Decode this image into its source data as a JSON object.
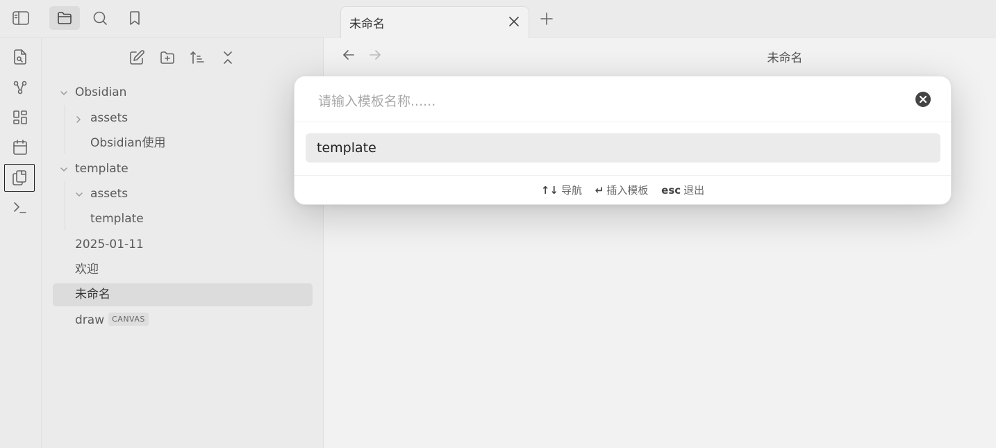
{
  "ribbon": {
    "items": [
      {
        "name": "open-quick-switcher-icon"
      },
      {
        "name": "graph-view-icon"
      },
      {
        "name": "canvas-icon"
      },
      {
        "name": "daily-note-calendar-icon"
      },
      {
        "name": "insert-template-icon"
      },
      {
        "name": "command-palette-icon"
      }
    ]
  },
  "sidebar_tabs": [
    "files",
    "search",
    "bookmarks"
  ],
  "file_tree": {
    "items": [
      {
        "label": "Obsidian",
        "type": "folder",
        "expanded": true,
        "depth": 0
      },
      {
        "label": "assets",
        "type": "folder",
        "expanded": false,
        "depth": 1
      },
      {
        "label": "Obsidian使用",
        "type": "file",
        "depth": 1
      },
      {
        "label": "template",
        "type": "folder",
        "expanded": true,
        "depth": 0
      },
      {
        "label": "assets",
        "type": "folder",
        "expanded": true,
        "depth": 1
      },
      {
        "label": "template",
        "type": "file",
        "depth": 1
      },
      {
        "label": "2025-01-11",
        "type": "file",
        "depth": 0
      },
      {
        "label": "欢迎",
        "type": "file",
        "depth": 0
      },
      {
        "label": "未命名",
        "type": "file",
        "depth": 0,
        "selected": true
      },
      {
        "label": "draw",
        "type": "file",
        "depth": 0,
        "tag": "CANVAS"
      }
    ]
  },
  "tabs": [
    {
      "title": "未命名"
    }
  ],
  "view": {
    "title": "未命名"
  },
  "modal": {
    "placeholder": "请输入模板名称......",
    "value": "",
    "suggestions": [
      "template"
    ],
    "instructions": [
      {
        "key": "↑↓",
        "text": "导航"
      },
      {
        "key": "↵",
        "text": "插入模板"
      },
      {
        "key": "esc",
        "text": "退出"
      }
    ]
  }
}
